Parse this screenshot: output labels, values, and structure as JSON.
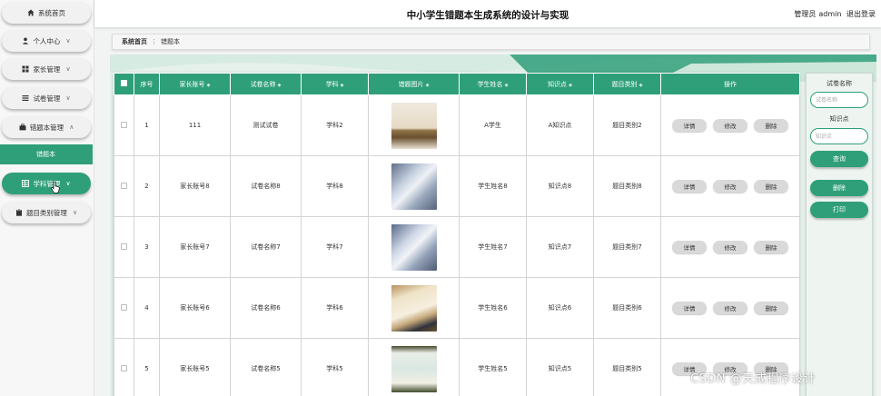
{
  "header": {
    "title": "中小学生错题本生成系统的设计与实现",
    "user_role": "管理员",
    "user_name": "admin",
    "logout": "退出登录"
  },
  "sidebar": {
    "items": [
      {
        "label": "系统首页",
        "icon": "home-icon",
        "chevron": ""
      },
      {
        "label": "个人中心",
        "icon": "user-icon",
        "chevron": "∨"
      },
      {
        "label": "家长管理",
        "icon": "grid-icon",
        "chevron": "∨"
      },
      {
        "label": "试卷管理",
        "icon": "list-icon",
        "chevron": "∨"
      },
      {
        "label": "错题本管理",
        "icon": "briefcase-icon",
        "chevron": "∧"
      },
      {
        "label": "学科管理",
        "icon": "table-icon",
        "chevron": "∨"
      },
      {
        "label": "题目类别管理",
        "icon": "clipboard-icon",
        "chevron": "∨"
      }
    ],
    "sub_item": "错题本"
  },
  "breadcrumb": {
    "home": "系统首页",
    "current": "错题本"
  },
  "table": {
    "columns": [
      "序号",
      "家长账号",
      "试卷名称",
      "学科",
      "错题图片",
      "学生姓名",
      "知识点",
      "题目类别",
      "操作"
    ],
    "sort_glyph": "◆",
    "actions": {
      "detail": "详情",
      "edit": "修改",
      "delete": "删除"
    },
    "rows": [
      {
        "index": "1",
        "parent": "111",
        "paper": "测试试卷",
        "subject": "学科2",
        "student": "A学生",
        "knowledge": "A知识点",
        "category": "题目类别2"
      },
      {
        "index": "2",
        "parent": "家长账号8",
        "paper": "试卷名称8",
        "subject": "学科8",
        "student": "学生姓名8",
        "knowledge": "知识点8",
        "category": "题目类别8"
      },
      {
        "index": "3",
        "parent": "家长账号7",
        "paper": "试卷名称7",
        "subject": "学科7",
        "student": "学生姓名7",
        "knowledge": "知识点7",
        "category": "题目类别7"
      },
      {
        "index": "4",
        "parent": "家长账号6",
        "paper": "试卷名称6",
        "subject": "学科6",
        "student": "学生姓名6",
        "knowledge": "知识点6",
        "category": "题目类别6"
      },
      {
        "index": "5",
        "parent": "家长账号5",
        "paper": "试卷名称5",
        "subject": "学科5",
        "student": "学生姓名5",
        "knowledge": "知识点5",
        "category": "题目类别5"
      }
    ]
  },
  "search": {
    "paper_label": "试卷名称",
    "paper_placeholder": "试卷名称",
    "knowledge_label": "知识点",
    "knowledge_placeholder": "知识点",
    "search_button": "查询",
    "delete_button": "删除",
    "print_button": "打印"
  },
  "watermark": "CSDN @天成程序设计",
  "colors": {
    "accent": "#2f9f7a",
    "button_gray": "#d9d9d9"
  }
}
